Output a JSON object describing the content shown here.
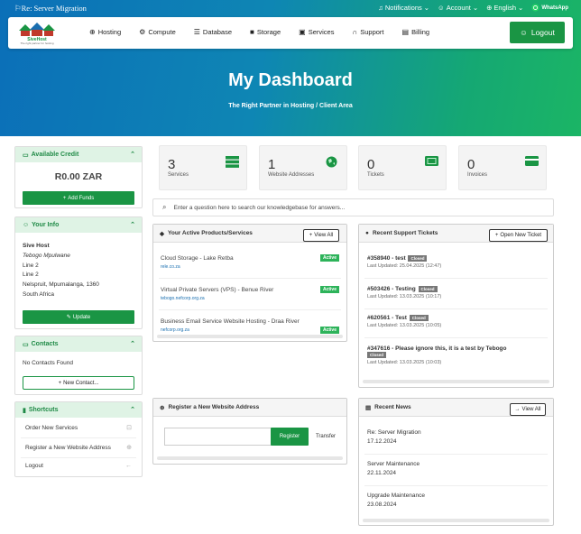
{
  "topbar": {
    "announcement": "Re: Server Migration",
    "notifications": "Notifications",
    "account": "Account",
    "language": "English",
    "whatsapp": "WhatsApp"
  },
  "nav": {
    "logo_name": "SiveHost",
    "logo_tagline": "The right partner for hosting",
    "items": [
      {
        "label": "Hosting",
        "icon": "globe-icon"
      },
      {
        "label": "Compute",
        "icon": "gear-icon"
      },
      {
        "label": "Database",
        "icon": "database-icon"
      },
      {
        "label": "Storage",
        "icon": "box-icon"
      },
      {
        "label": "Services",
        "icon": "gift-icon"
      },
      {
        "label": "Support",
        "icon": "headset-icon"
      },
      {
        "label": "Billing",
        "icon": "invoice-icon"
      }
    ],
    "logout": "Logout"
  },
  "hero": {
    "title": "My Dashboard",
    "crumb_home": "The Right Partner in Hosting",
    "crumb_sep": "/",
    "crumb_current": "Client Area"
  },
  "credit": {
    "title": "Available Credit",
    "amount": "R0.00 ZAR",
    "button": "Add Funds"
  },
  "info": {
    "title": "Your Info",
    "name": "Sive Host",
    "contact": "Tebogo Mpulwane",
    "line1": "Line 2",
    "line2": "Line 2",
    "city": "Nelspruit, Mpumalanga, 1360",
    "country": "South Africa",
    "button": "Update"
  },
  "contacts": {
    "title": "Contacts",
    "empty": "No Contacts Found",
    "button": "New Contact..."
  },
  "shortcuts": {
    "title": "Shortcuts",
    "items": [
      "Order New Services",
      "Register a New Website Address",
      "Logout"
    ]
  },
  "stats": [
    {
      "number": "3",
      "label": "Services"
    },
    {
      "number": "1",
      "label": "Website Addresses"
    },
    {
      "number": "0",
      "label": "Tickets"
    },
    {
      "number": "0",
      "label": "Invoices"
    }
  ],
  "search": {
    "placeholder": "Enter a question here to search our knowledgebase for answers..."
  },
  "products": {
    "title": "Your Active Products/Services",
    "button": "View All",
    "items": [
      {
        "name": "Cloud Storage - Lake Retba",
        "domain": "rele.co.za",
        "status": "Active"
      },
      {
        "name": "Virtual Private Servers (VPS) - Benue River",
        "domain": "tebogo.nefcorp.org.za",
        "status": "Active"
      },
      {
        "name": "Business Email Service Website Hosting - Draa River",
        "domain": "nefcorp.org.za",
        "status": "Active"
      }
    ]
  },
  "tickets": {
    "title": "Recent Support Tickets",
    "button": "Open New Ticket",
    "items": [
      {
        "subject": "#358940 - test",
        "status": "Closed",
        "updated": "Last Updated: 25.04.2025 (12:47)"
      },
      {
        "subject": "#503426 - Testing",
        "status": "Closed",
        "updated": "Last Updated: 13.03.2025 (10:17)"
      },
      {
        "subject": "#620561 - Test",
        "status": "Closed",
        "updated": "Last Updated: 13.03.2025 (10:05)"
      },
      {
        "subject": "#347616 - Please ignore this, it is a test by Tebogo",
        "status": "Closed",
        "updated": "Last Updated: 13.03.2025 (10:03)"
      }
    ]
  },
  "domain_reg": {
    "title": "Register a New Website Address",
    "register": "Register",
    "transfer": "Transfer"
  },
  "news": {
    "title": "Recent News",
    "button": "View All",
    "items": [
      {
        "title": "Re: Server Migration",
        "date": "17.12.2024"
      },
      {
        "title": "Server Maintenance",
        "date": "22.11.2024"
      },
      {
        "title": "Upgrade Maintenance",
        "date": "23.08.2024"
      }
    ]
  },
  "colors": {
    "brand_green": "#1a9544",
    "hero_blue": "#0b6fb8",
    "hero_green": "#1bb565",
    "badge_active": "#2db35a"
  }
}
